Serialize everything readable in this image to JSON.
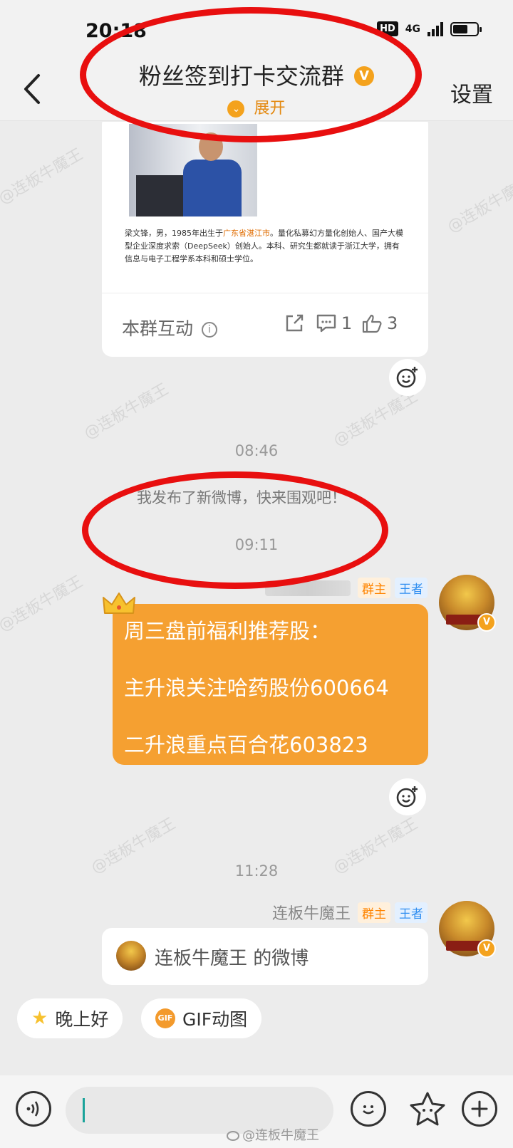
{
  "status_bar": {
    "time": "20:18",
    "hd": "HD",
    "network": "4G"
  },
  "header": {
    "title": "粉丝签到打卡交流群",
    "title_badge": "V",
    "expand_label": "展开",
    "expand_icon": "chevron-down-icon",
    "settings_label": "设置"
  },
  "post_card": {
    "text_before": "梁文锋，男，1985年出生于",
    "text_highlight": "广东省湛江市",
    "text_after": "。量化私募幻方量化创始人、国产大模型企业深度求索（DeepSeek）创始人。本科、研究生都就读于浙江大学，拥有信息与电子工程学系本科和硕士学位。",
    "interact_label": "本群互动",
    "comment_count": "1",
    "like_count": "3"
  },
  "messages": {
    "time1": "08:46",
    "notice": "我发布了新微博，快来围观吧！",
    "time2": "09:11",
    "time3": "11:28"
  },
  "msg1": {
    "owner_tag": "群主",
    "rank_tag": "王者",
    "lines": [
      "周三盘前福利推荐股：",
      "主升浪关注哈药股份600664",
      "二升浪重点百合花603823"
    ]
  },
  "msg2": {
    "sender": "连板牛魔王",
    "owner_tag": "群主",
    "rank_tag": "王者",
    "card_label": "连板牛魔王 的微博"
  },
  "quick_replies": [
    {
      "label": "晚上好",
      "icon": "star-face-icon"
    },
    {
      "label": "GIF动图",
      "icon": "gif-icon",
      "icon_text": "GIF"
    }
  ],
  "input_bar": {
    "value": "",
    "placeholder": ""
  },
  "watermark": {
    "text": "@连板牛魔王"
  },
  "colors": {
    "accent": "#f4a21d",
    "bubble": "#f5a031",
    "annotation": "#e80f0f",
    "background": "#ececec"
  }
}
